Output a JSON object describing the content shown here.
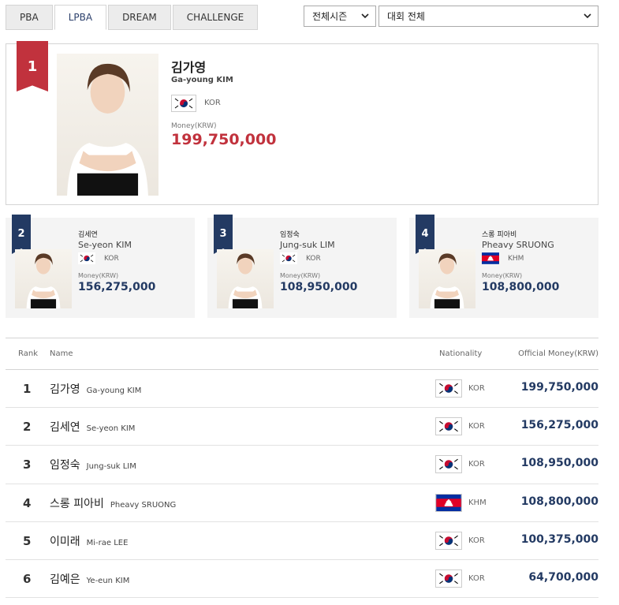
{
  "tabs": [
    {
      "label": "PBA",
      "active": false
    },
    {
      "label": "LPBA",
      "active": true
    },
    {
      "label": "DREAM",
      "active": false
    },
    {
      "label": "CHALLENGE",
      "active": false
    }
  ],
  "filters": {
    "season": "전체시즌",
    "tournament": "대회 전체"
  },
  "top3_cards": {
    "first": {
      "rank": "1",
      "name_ko": "김가영",
      "name_en": "Ga-young KIM",
      "nationality": "KOR",
      "flag": "korea-flag-icon",
      "money_label": "Money(KRW)",
      "money": "199,750,000"
    },
    "others": [
      {
        "rank": "2",
        "name_ko": "김세연",
        "name_en": "Se-yeon KIM",
        "nationality": "KOR",
        "flag": "korea-flag-icon",
        "money_label": "Money(KRW)",
        "money": "156,275,000"
      },
      {
        "rank": "3",
        "name_ko": "임정숙",
        "name_en": "Jung-suk LIM",
        "nationality": "KOR",
        "flag": "korea-flag-icon",
        "money_label": "Money(KRW)",
        "money": "108,950,000"
      },
      {
        "rank": "4",
        "name_ko": "스롱 피아비",
        "name_en": "Pheavy SRUONG",
        "nationality": "KHM",
        "flag": "cambodia-flag-icon",
        "money_label": "Money(KRW)",
        "money": "108,800,000"
      }
    ]
  },
  "table": {
    "headers": {
      "rank": "Rank",
      "name": "Name",
      "nationality": "Nationality",
      "money": "Official Money(KRW)"
    },
    "rows": [
      {
        "rank": "1",
        "name_ko": "김가영",
        "name_en": "Ga-young KIM",
        "nationality": "KOR",
        "money": "199,750,000"
      },
      {
        "rank": "2",
        "name_ko": "김세연",
        "name_en": "Se-yeon KIM",
        "nationality": "KOR",
        "money": "156,275,000"
      },
      {
        "rank": "3",
        "name_ko": "임정숙",
        "name_en": "Jung-suk LIM",
        "nationality": "KOR",
        "money": "108,950,000"
      },
      {
        "rank": "4",
        "name_ko": "스롱 피아비",
        "name_en": "Pheavy SRUONG",
        "nationality": "KHM",
        "money": "108,800,000"
      },
      {
        "rank": "5",
        "name_ko": "이미래",
        "name_en": "Mi-rae LEE",
        "nationality": "KOR",
        "money": "100,375,000"
      },
      {
        "rank": "6",
        "name_ko": "김예은",
        "name_en": "Ye-eun KIM",
        "nationality": "KOR",
        "money": "64,700,000"
      }
    ]
  },
  "colors": {
    "rank1_ribbon": "#c1323d",
    "ribbon": "#233a63",
    "money_top": "#c1323d",
    "money": "#233a63"
  }
}
